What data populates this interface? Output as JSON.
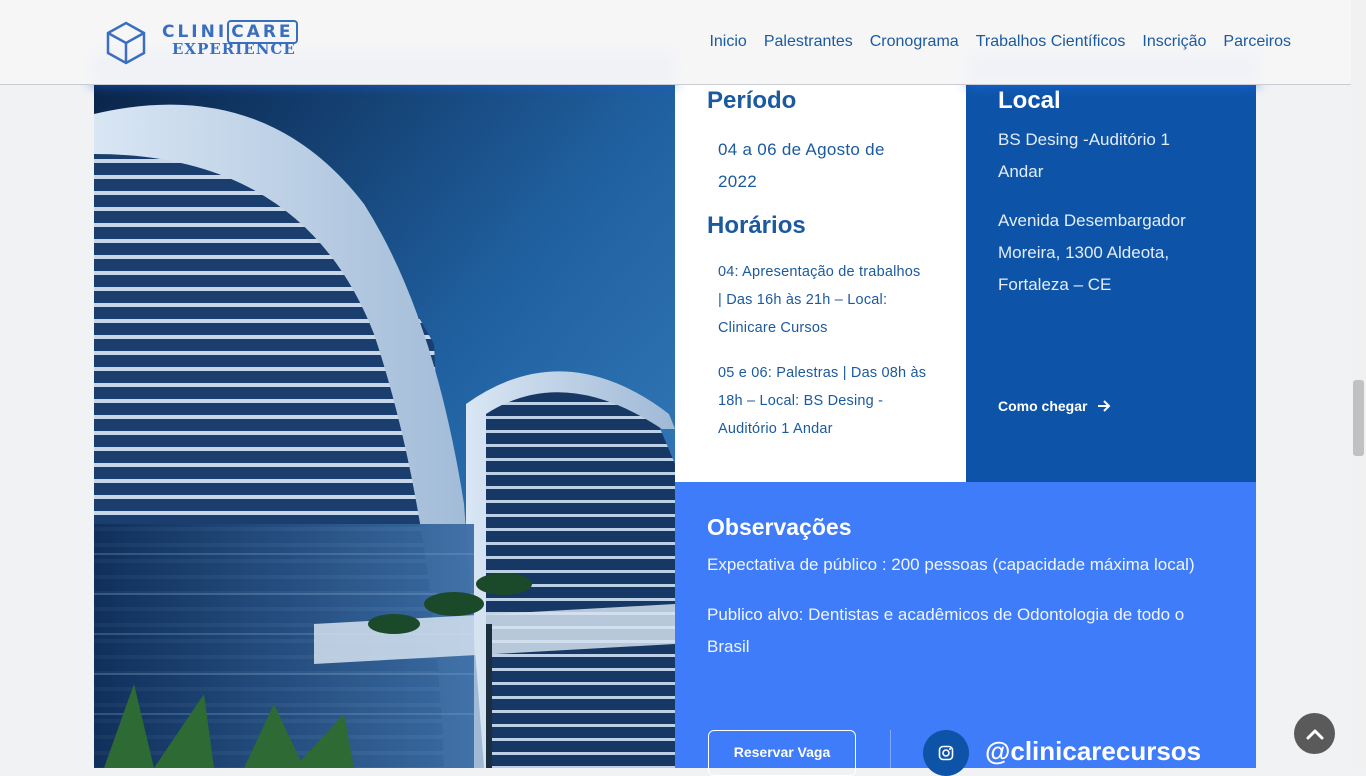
{
  "header": {
    "logo": {
      "line1_a": "CLINI",
      "line1_b": "CARE",
      "line2": "EXPERIENCE"
    },
    "nav": [
      "Inicio",
      "Palestrantes",
      "Cronograma",
      "Trabalhos Científicos",
      "Inscrição",
      "Parceiros"
    ]
  },
  "periodo": {
    "title": "Período",
    "text": "04 a 06 de Agosto de 2022"
  },
  "horarios": {
    "title": "Horários",
    "items": [
      "04: Apresentação de trabalhos | Das 16h às 21h –  Local: Clinicare Cursos",
      "05 e 06: Palestras | Das 08h às 18h –  Local: BS Desing - Auditório 1 Andar"
    ]
  },
  "local": {
    "title": "Local",
    "venue": "BS Desing -Auditório 1 Andar",
    "address": "Avenida Desembargador Moreira, 1300 Aldeota, Fortaleza – CE",
    "directions_label": "Como chegar"
  },
  "observacoes": {
    "title": "Observações",
    "items": [
      "Expectativa de público : 200 pessoas (capacidade máxima local)",
      "Publico alvo: Dentistas e acadêmicos de Odontologia de todo o Brasil"
    ],
    "reserve_label": "Reservar Vaga",
    "instagram_handle": "@clinicarecursos"
  },
  "icons": {
    "logo": "cube-logo-icon",
    "directions": "arrow-right-icon",
    "social": "instagram-icon",
    "back_to_top": "chevron-up-icon"
  },
  "colors": {
    "nav_text": "#1c5aa0",
    "local_bg": "#0d54a8",
    "obs_bg": "#3f7cf9",
    "white_card": "#ffffff",
    "scroll_top_bg": "#5a5a5a"
  }
}
